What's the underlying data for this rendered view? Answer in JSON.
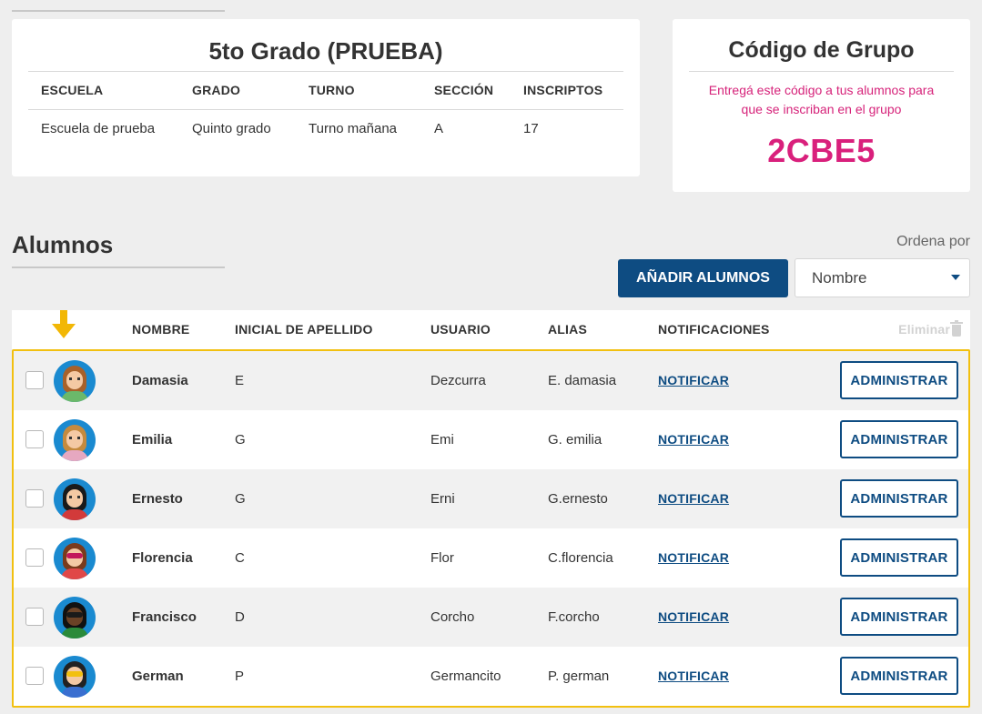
{
  "group": {
    "title": "5to Grado (PRUEBA)",
    "columns": [
      "ESCUELA",
      "GRADO",
      "TURNO",
      "SECCIÓN",
      "INSCRIPTOS"
    ],
    "values": [
      "Escuela de prueba",
      "Quinto grado",
      "Turno mañana",
      "A",
      "17"
    ]
  },
  "code_card": {
    "title": "Código de Grupo",
    "description_line1": "Entregá este código a tus alumnos para",
    "description_line2": "que se inscriban en el grupo",
    "code": "2CBE5"
  },
  "students_section": {
    "title": "Alumnos",
    "sort_label": "Ordena por",
    "add_button": "AÑADIR ALUMNOS",
    "sort_value": "Nombre"
  },
  "table": {
    "headers": {
      "nombre": "NOMBRE",
      "inicial": "INICIAL DE APELLIDO",
      "usuario": "USUARIO",
      "alias": "ALIAS",
      "notificaciones": "NOTIFICACIONES",
      "eliminar": "Eliminar"
    },
    "rows": [
      {
        "nombre": "Damasia",
        "inicial": "E",
        "usuario": "Dezcurra",
        "alias": "E. damasia",
        "notify": "NOTIFICAR",
        "admin": "ADMINISTRAR"
      },
      {
        "nombre": "Emilia",
        "inicial": "G",
        "usuario": "Emi",
        "alias": "G. emilia",
        "notify": "NOTIFICAR",
        "admin": "ADMINISTRAR"
      },
      {
        "nombre": "Ernesto",
        "inicial": "G",
        "usuario": "Erni",
        "alias": "G.ernesto",
        "notify": "NOTIFICAR",
        "admin": "ADMINISTRAR"
      },
      {
        "nombre": "Florencia",
        "inicial": "C",
        "usuario": "Flor",
        "alias": "C.florencia",
        "notify": "NOTIFICAR",
        "admin": "ADMINISTRAR"
      },
      {
        "nombre": "Francisco",
        "inicial": "D",
        "usuario": "Corcho",
        "alias": "F.corcho",
        "notify": "NOTIFICAR",
        "admin": "ADMINISTRAR"
      },
      {
        "nombre": "German",
        "inicial": "P",
        "usuario": "Germancito",
        "alias": "P. german",
        "notify": "NOTIFICAR",
        "admin": "ADMINISTRAR"
      }
    ]
  },
  "colors": {
    "primary": "#0e4c82",
    "code_accent": "#d9207c",
    "highlight": "#f2c010"
  }
}
